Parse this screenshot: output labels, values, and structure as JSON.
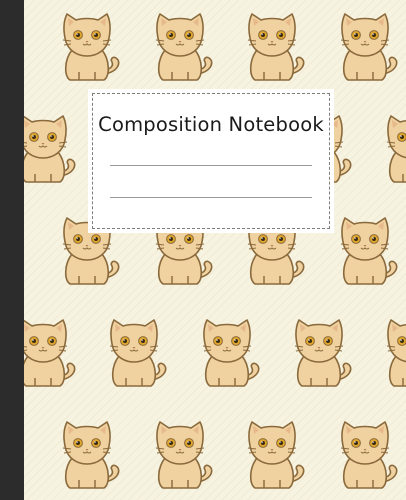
{
  "cover": {
    "title": "Composition Notebook",
    "colors": {
      "background": "#f7f3e1",
      "spine": "#2c2c2c",
      "cat_fur": "#f0d1a0",
      "cat_outline": "#8a6a3c",
      "cat_eye": "#e0a72a"
    },
    "pattern_icon": "cat-icon"
  }
}
